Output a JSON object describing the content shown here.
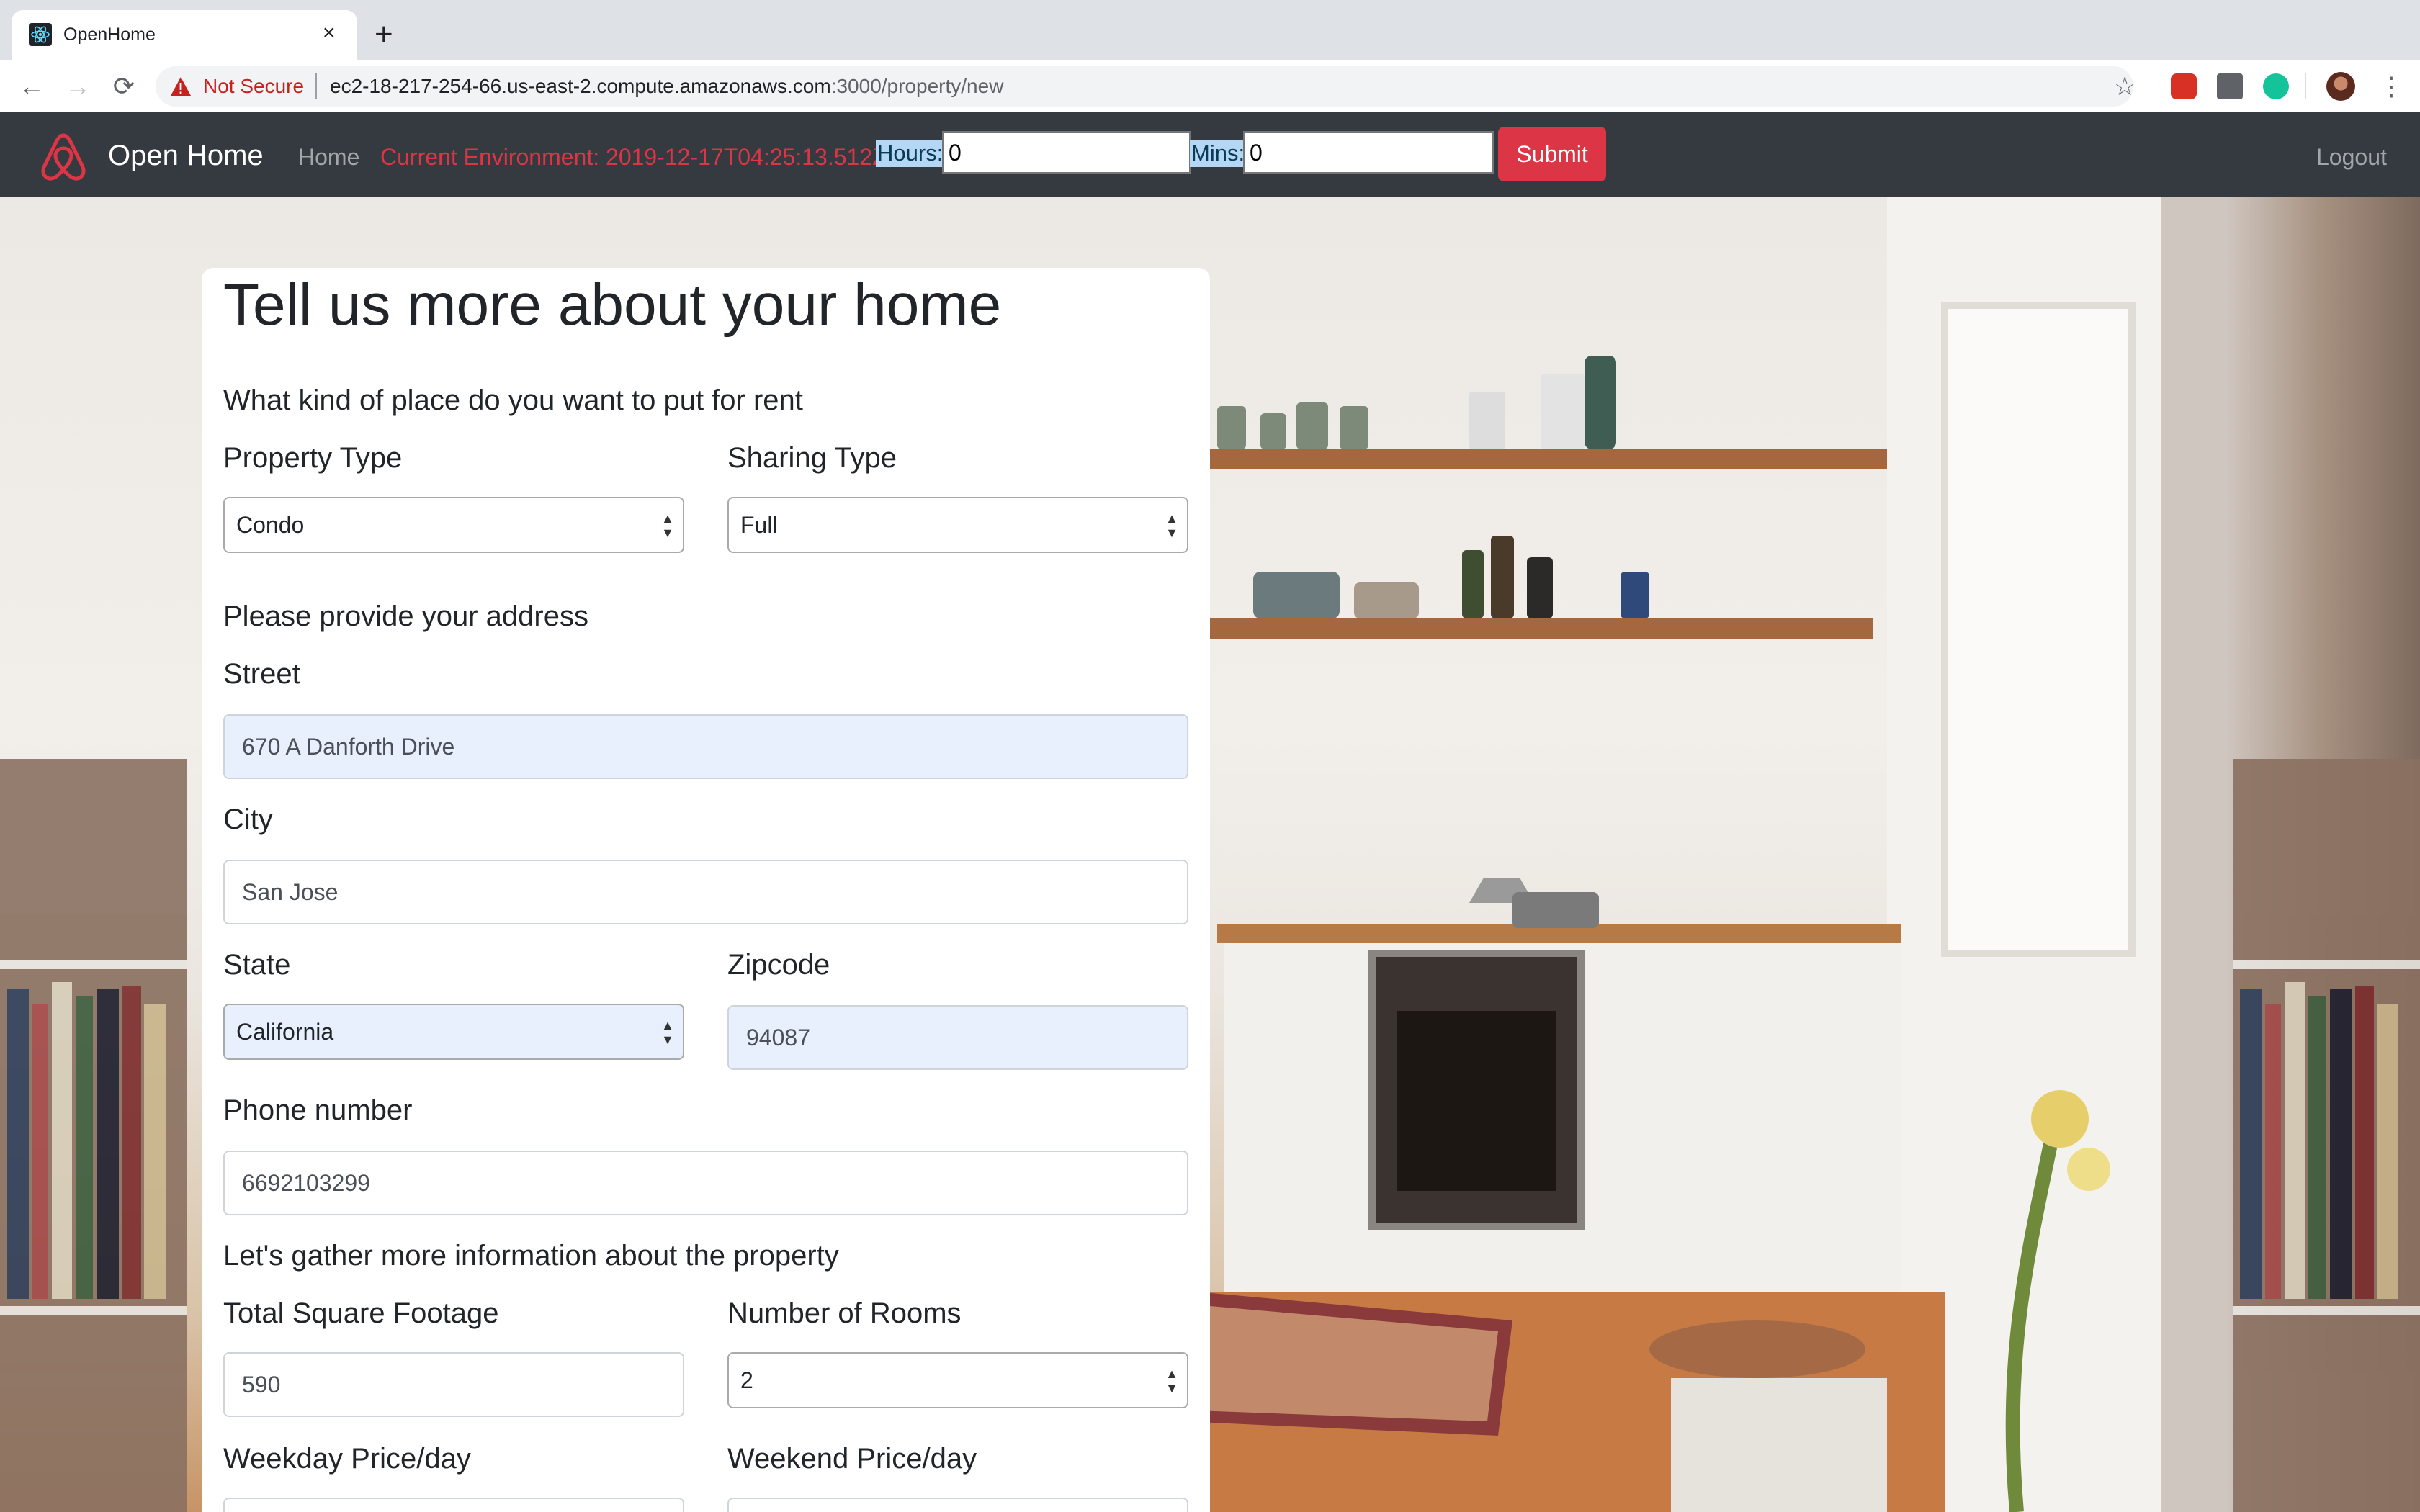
{
  "browser": {
    "tab_title": "OpenHome",
    "tab_close": "×",
    "new_tab": "+",
    "security_label": "Not Secure",
    "url_host": "ec2-18-217-254-66.us-east-2.compute.amazonaws.com",
    "url_path": ":3000/property/new",
    "icons": {
      "back": "←",
      "forward": "→",
      "reload": "⟳",
      "star": "☆",
      "menu": "⋮"
    }
  },
  "navbar": {
    "brand": "Open Home",
    "home": "Home",
    "environment": "Current Environment: 2019-12-17T04:25:13.512Z",
    "hours_label": "Hours:",
    "hours_value": "0",
    "mins_label": "Mins:",
    "mins_value": "0",
    "submit": "Submit",
    "logout": "Logout"
  },
  "form": {
    "title": "Tell us more about your home",
    "section_place": "What kind of place do you want to put for rent",
    "property_type": {
      "label": "Property Type",
      "value": "Condo"
    },
    "sharing_type": {
      "label": "Sharing Type",
      "value": "Full"
    },
    "section_address": "Please provide your address",
    "street": {
      "label": "Street",
      "value": "670 A Danforth Drive"
    },
    "city": {
      "label": "City",
      "value": "San Jose"
    },
    "state": {
      "label": "State",
      "value": "California"
    },
    "zipcode": {
      "label": "Zipcode",
      "value": "94087"
    },
    "phone": {
      "label": "Phone number",
      "value": "6692103299"
    },
    "section_property": "Let's gather more information about the property",
    "square_footage": {
      "label": "Total Square Footage",
      "value": "590"
    },
    "rooms": {
      "label": "Number of Rooms",
      "value": "2"
    },
    "weekday_price": {
      "label": "Weekday Price/day",
      "value": ""
    },
    "weekend_price": {
      "label": "Weekend Price/day",
      "value": ""
    }
  },
  "colors": {
    "navbar_bg": "#343a40",
    "brand_accent": "#dc3545",
    "autofill_bg": "#e8f0fe"
  }
}
